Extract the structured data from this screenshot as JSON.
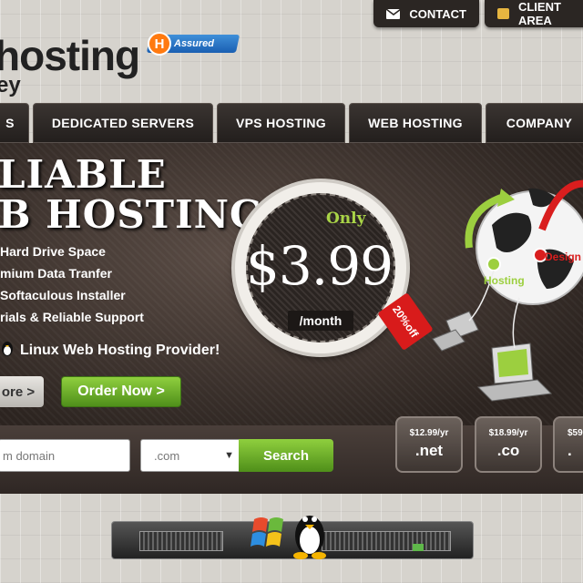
{
  "header": {
    "contact_label": "CONTACT",
    "client_area_label": "CLIENT AREA",
    "logo_main": "hosting",
    "logo_sub": "ey",
    "badge_letter": "H",
    "badge_label": "Assured"
  },
  "nav": {
    "items": [
      {
        "label": "S"
      },
      {
        "label": "DEDICATED SERVERS"
      },
      {
        "label": "VPS HOSTING"
      },
      {
        "label": "WEB HOSTING"
      },
      {
        "label": "COMPANY"
      }
    ]
  },
  "hero": {
    "headline_1": "LIABLE",
    "headline_2": "B HOSTING",
    "features": [
      "Hard Drive Space",
      "mium Data Tranfer",
      "Softaculous Installer",
      "rials & Reliable Support"
    ],
    "linux_line": "Linux Web Hosting Provider!",
    "more_button": "ore >",
    "order_button": "Order Now >",
    "price_only": "Only",
    "price": "$3.99",
    "price_period": "/month",
    "discount_tag": "20%off",
    "globe_label_hosting": "Hosting",
    "globe_label_design": "Design"
  },
  "search": {
    "domain_placeholder": "m domain",
    "tld_selected": ".com",
    "search_label": "Search"
  },
  "tld_cards": [
    {
      "price": "$12.99/yr",
      "ext": ".net"
    },
    {
      "price": "$18.99/yr",
      "ext": ".co"
    },
    {
      "price": "$59",
      "ext": "."
    }
  ],
  "colors": {
    "accent_green": "#7cbf2e",
    "nav_dark": "#2b2623",
    "badge_blue": "#2a74c8",
    "discount_red": "#d81b1b"
  }
}
